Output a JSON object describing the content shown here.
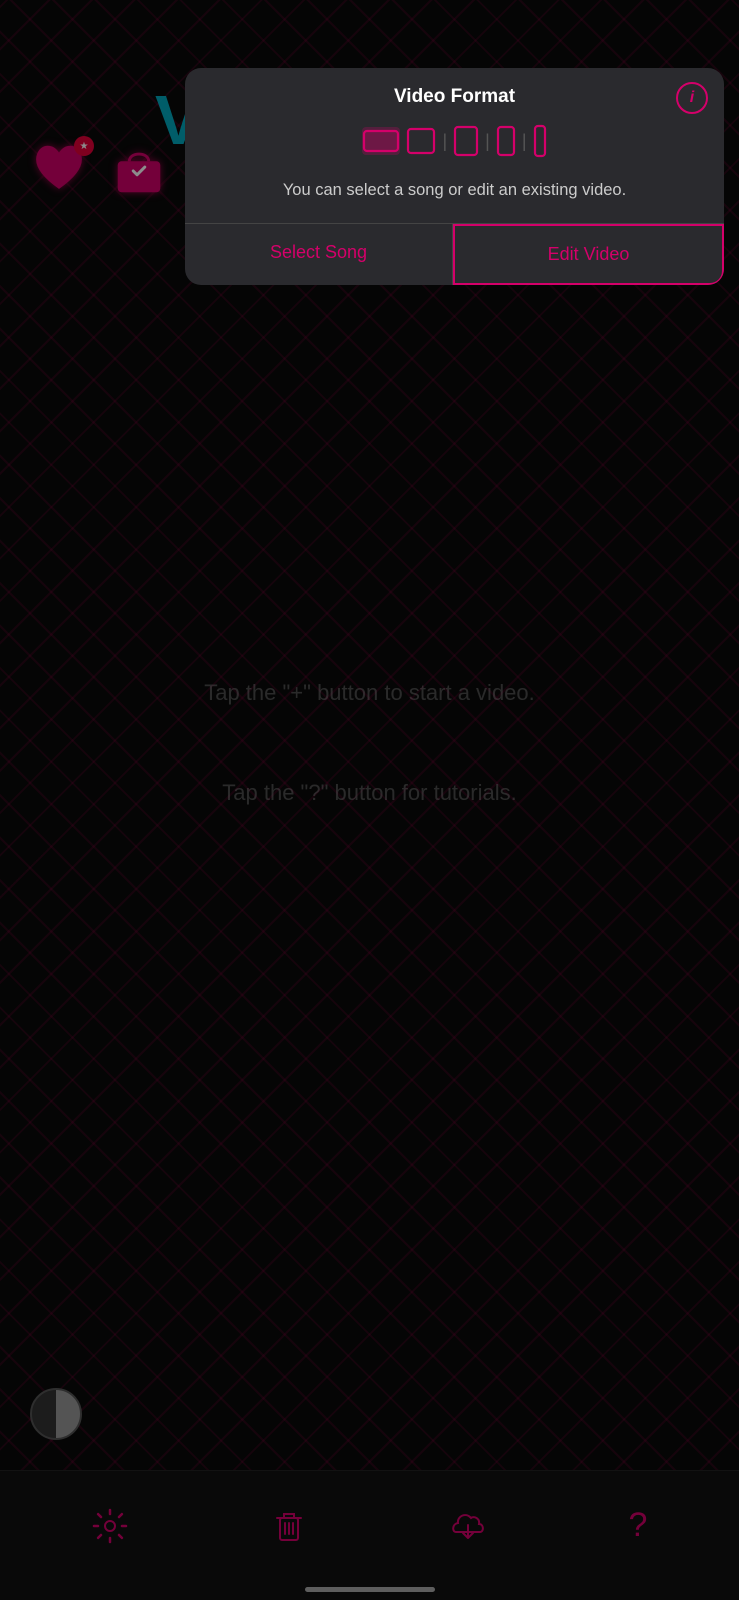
{
  "app": {
    "background_hint1": "Tap the \"+\" button to start a video.",
    "background_hint2": "Tap the \"?\" button for tutorials."
  },
  "modal": {
    "title": "Video Format",
    "info_label": "i",
    "description": "You can select a song or edit an existing video.",
    "btn_select_song": "Select Song",
    "btn_edit_video": "Edit Video",
    "formats": [
      {
        "id": "landscape",
        "label": "landscape"
      },
      {
        "id": "square-wide",
        "label": "square-wide"
      },
      {
        "id": "portrait-mid",
        "label": "portrait-mid"
      },
      {
        "id": "portrait-narrow",
        "label": "portrait-narrow"
      },
      {
        "id": "portrait-tall",
        "label": "portrait-tall"
      }
    ]
  },
  "bottom_bar": {
    "settings_label": "settings",
    "trash_label": "trash",
    "download_label": "download",
    "help_label": "help"
  },
  "icons": {
    "heart": "heart-icon",
    "bag": "bag-icon",
    "settings": "gear-icon",
    "trash": "trash-icon",
    "download": "download-cloud-icon",
    "help": "question-icon"
  }
}
